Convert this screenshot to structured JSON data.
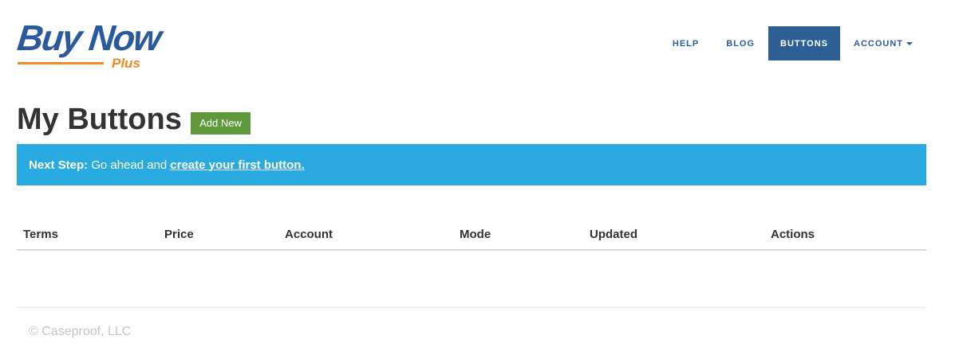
{
  "brand": {
    "name": "Buy Now",
    "suffix": "Plus",
    "colors": {
      "primary": "#2a5a9c",
      "accent": "#f28a22"
    }
  },
  "nav": {
    "items": [
      {
        "label": "HELP",
        "active": false
      },
      {
        "label": "BLOG",
        "active": false
      },
      {
        "label": "BUTTONS",
        "active": true
      },
      {
        "label": "ACCOUNT",
        "active": false,
        "has_dropdown": true
      }
    ],
    "active_color": "#2d5f94"
  },
  "page": {
    "title": "My Buttons",
    "add_button_label": "Add New",
    "add_button_color": "#5f993b"
  },
  "alert": {
    "prefix": "Next Step:",
    "text": "Go ahead and",
    "link_text": "create your first button.",
    "color": "#29abe2"
  },
  "table": {
    "columns": [
      "Terms",
      "Price",
      "Account",
      "Mode",
      "Updated",
      "Actions"
    ],
    "rows": []
  },
  "footer": {
    "copyright": "© Caseproof, LLC"
  }
}
